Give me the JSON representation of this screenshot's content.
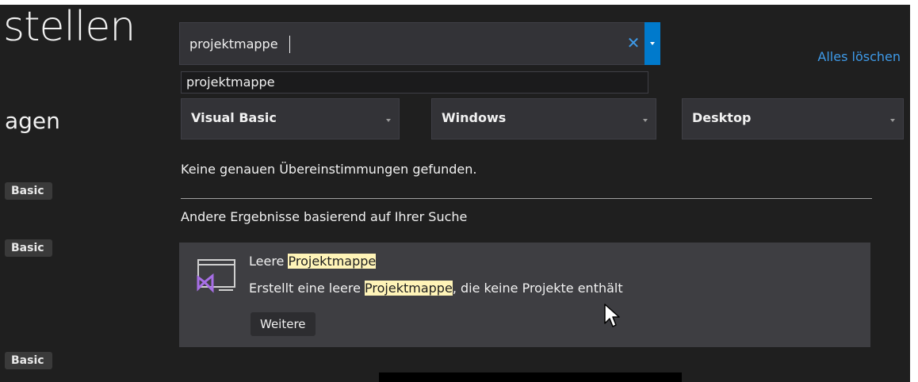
{
  "header": {
    "title_fragment": "stellen",
    "subtitle_fragment": "agen"
  },
  "left_tags": [
    "Basic",
    "Basic",
    "Basic"
  ],
  "search": {
    "value": "projektmappe",
    "placeholder": "",
    "clear_icon": "close-icon",
    "dropdown_icon": "chevron-down-icon",
    "accent_color": "#007acc"
  },
  "suggestion": "projektmappe",
  "clear_all_label": "Alles löschen",
  "filters": {
    "language": "Visual Basic",
    "platform": "Windows",
    "project_type": "Desktop"
  },
  "no_exact_matches": "Keine genauen Übereinstimmungen gefunden.",
  "other_results_heading": "Andere Ergebnisse basierend auf Ihrer Suche",
  "result": {
    "icon": "visual-studio-solution-icon",
    "title_prefix": "Leere ",
    "title_highlight": "Projektmappe",
    "desc_prefix": "Erstellt eine leere ",
    "desc_highlight": "Projektmappe",
    "desc_suffix": ", die keine Projekte enthält",
    "more_label": "Weitere",
    "highlight_color": "#fff4b8"
  }
}
